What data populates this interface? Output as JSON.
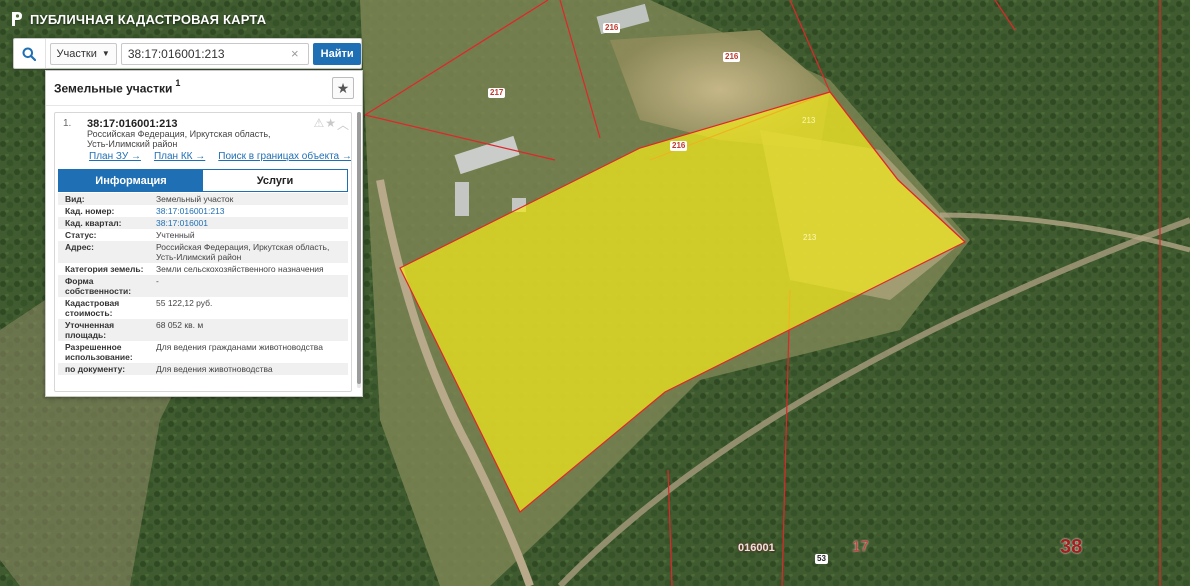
{
  "app": {
    "title": "ПУБЛИЧНАЯ КАДАСТРОВАЯ КАРТА"
  },
  "search": {
    "type_selected": "Участки",
    "value": "38:17:016001:213",
    "button_label": "Найти"
  },
  "results": {
    "title": "Земельные участки",
    "count": "1",
    "item": {
      "index": "1.",
      "cadnum": "38:17:016001:213",
      "address": "Российская Федерация, Иркутская область, Усть-Илимский район",
      "links": [
        "План ЗУ →",
        "План КК →",
        "Поиск в границах объекта →"
      ],
      "tabs": [
        "Информация",
        "Услуги"
      ],
      "fields": [
        {
          "key": "Вид:",
          "value": "Земельный участок"
        },
        {
          "key": "Кад. номер:",
          "value": "38:17:016001:213",
          "link": true
        },
        {
          "key": "Кад. квартал:",
          "value": "38:17:016001",
          "link": true
        },
        {
          "key": "Статус:",
          "value": "Учтенный"
        },
        {
          "key": "Адрес:",
          "value": "Российская Федерация, Иркутская область, Усть-Илимский район"
        },
        {
          "key": "Категория земель:",
          "value": "Земли сельскохозяйственного назначения"
        },
        {
          "key": "Форма собственности:",
          "value": "-"
        },
        {
          "key": "Кадастровая стоимость:",
          "value": "55 122,12 руб."
        },
        {
          "key": "Уточненная площадь:",
          "value": "68 052 кв. м"
        },
        {
          "key": "Разрешенное использование:",
          "value": "Для ведения гражданами животноводства"
        },
        {
          "key": "по документу:",
          "value": "Для ведения животноводства"
        }
      ]
    }
  },
  "map": {
    "labels": {
      "l216a": "216",
      "l216b": "216",
      "l216c": "216",
      "l217": "217",
      "l213a": "213",
      "l213b": "213",
      "quarter": "016001",
      "q53": "53",
      "district": "17",
      "region": "38"
    },
    "colors": {
      "parcel_fill": "#f3ea1c",
      "boundary": "#e0262a"
    }
  }
}
